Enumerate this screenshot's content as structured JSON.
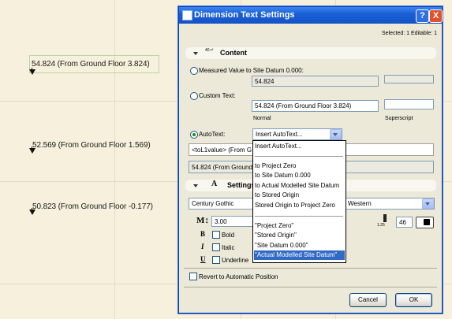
{
  "canvas": {
    "labels": [
      "54.824 (From Ground Floor 3.824)",
      "52.569 (From Ground Floor 1.569)",
      "50.823 (From Ground Floor -0.177)"
    ]
  },
  "dialog": {
    "title": "Dimension Text Settings",
    "help_label": "?",
    "close_label": "X",
    "selection_info": "Selected: 1 Editable: 1",
    "content_section": {
      "title": "Content",
      "icon_text": "40 r²",
      "measured_label": "Measured Value to Site Datum 0.000:",
      "measured_value": "54.824",
      "custom_label": "Custom Text:",
      "custom_value": "54.824 (From Ground Floor 3.824)",
      "normal_label": "Normal",
      "superscript_label": "Superscript",
      "autotext_label": "AutoText:",
      "autotext_combo": "Insert AutoText...",
      "autotext_field": "<toL1value> (From G",
      "preview_field": "54.824 (From Ground F"
    },
    "dropdown": {
      "items": [
        "Insert AutoText...",
        "to Project Zero",
        "to Site Datum 0.000",
        "to Actual Modelled Site Datum",
        "to Stored Origin",
        "Stored Origin to Project Zero",
        "\"Project Zero\"",
        "\"Stored Origin\"",
        "\"Site Datum 0.000\"",
        "\"Actual Modelled Site Datum\""
      ],
      "selected_index": 9
    },
    "settings_section": {
      "title": "Settings",
      "font_name": "Century Gothic",
      "script_value": "Western",
      "size_value": "3.00",
      "pen_scale": "1.25",
      "pen_number": "46",
      "bold_label": "Bold",
      "italic_label": "Italic",
      "underline_label": "Underline"
    },
    "revert_label": "Revert to Automatic Position",
    "cancel_label": "Cancel",
    "ok_label": "OK",
    "colors": {
      "title_bar": "#1a5fd6",
      "dialog_bg": "#ece9d8",
      "selection": "#316ac5"
    }
  }
}
